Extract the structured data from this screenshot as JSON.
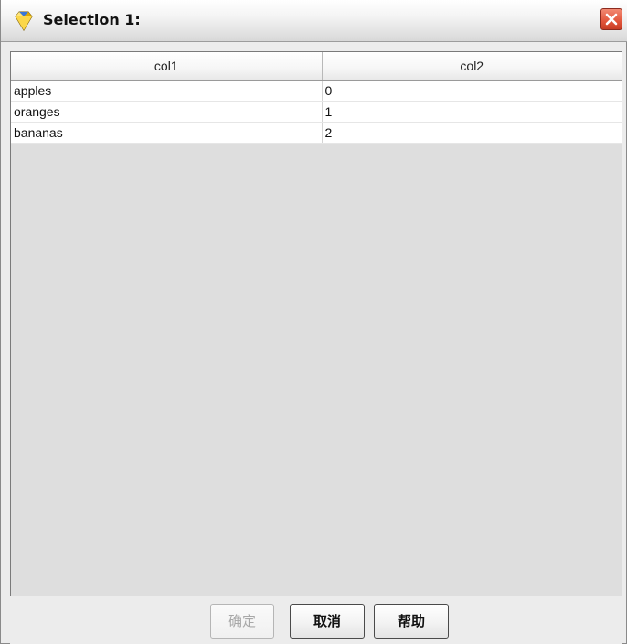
{
  "window": {
    "title": "Selection 1:",
    "title_icon": "diamond-icon",
    "close_icon": "close-icon"
  },
  "table": {
    "columns": [
      "col1",
      "col2"
    ],
    "rows": [
      [
        "apples",
        "0"
      ],
      [
        "oranges",
        "1"
      ],
      [
        "bananas",
        "2"
      ]
    ]
  },
  "buttons": {
    "ok_label": "确定",
    "ok_enabled": false,
    "cancel_label": "取消",
    "help_label": "帮助"
  },
  "colors": {
    "close_button": "#e2553b",
    "icon_gold": "#f5c400",
    "icon_blue": "#3a76d8"
  }
}
